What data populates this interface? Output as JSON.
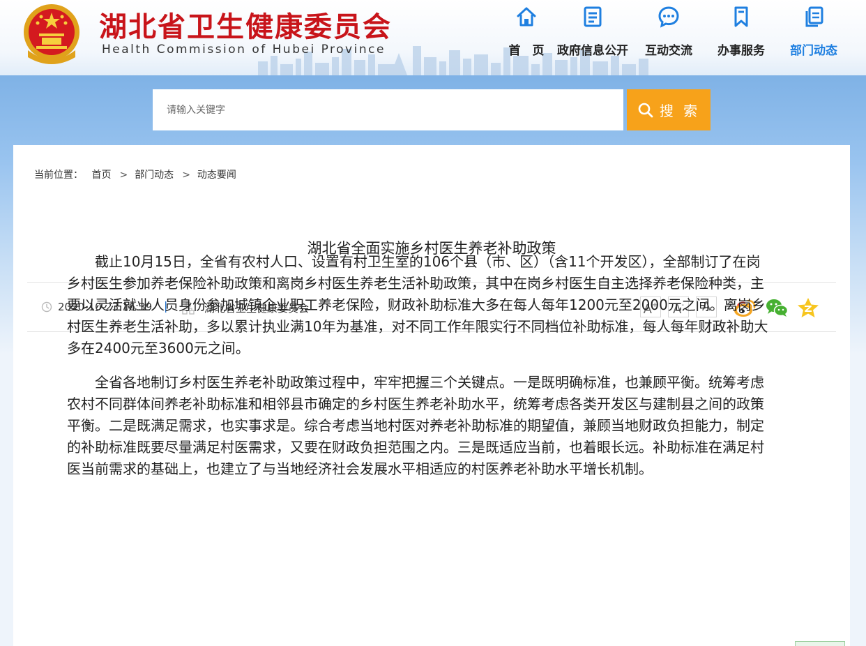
{
  "header": {
    "title": "湖北省卫生健康委员会",
    "subtitle": "Health Commission of Hubei Province",
    "emblem_icon": "national-emblem-icon",
    "title_color": "#c8141a"
  },
  "nav": {
    "accent_color": "#1e7fe0",
    "items": [
      {
        "label": "首　页",
        "icon": "home-icon"
      },
      {
        "label": "政府信息公开",
        "icon": "document-list-icon"
      },
      {
        "label": "互动交流",
        "icon": "chat-bubble-icon"
      },
      {
        "label": "办事服务",
        "icon": "bookmark-icon"
      },
      {
        "label": "部门动态",
        "icon": "copy-pages-icon",
        "active": true
      }
    ]
  },
  "search": {
    "placeholder": "请输入关键字",
    "button_label": "搜 索",
    "button_color": "#f7a21a"
  },
  "breadcrumb": {
    "prefix": "当前位置：",
    "items": [
      "首页",
      "部门动态",
      "动态要闻"
    ],
    "separator": ">"
  },
  "article": {
    "title": "湖北省全面实施乡村医生养老补助政策",
    "date": "2020-10-23 16:39",
    "divider": "|",
    "source": "湖北省卫生健康委员会",
    "font_controls": [
      "A+",
      "A-",
      "A"
    ],
    "share": [
      "weibo-icon",
      "wechat-icon",
      "favorite-star-icon"
    ],
    "paragraphs": [
      "截止10月15日，全省有农村人口、设置有村卫生室的106个县（市、区）（含11个开发区），全部制订了在岗乡村医生参加养老保险补助政策和离岗乡村医生养老生活补助政策，其中在岗乡村医生自主选择养老保险种类，主要以灵活就业人员身份参加城镇企业职工养老保险，财政补助标准大多在每人每年1200元至2000元之间。离岗乡村医生养老生活补助，多以累计执业满10年为基准，对不同工作年限实行不同档位补助标准，每人每年财政补助大多在2400元至3600元之间。",
      "全省各地制订乡村医生养老补助政策过程中，牢牢把握三个关键点。一是既明确标准，也兼顾平衡。统筹考虑农村不同群体间养老补助标准和相邻县市确定的乡村医生养老补助水平，统筹考虑各类开发区与建制县之间的政策平衡。二是既满足需求，也实事求是。综合考虑当地村医对养老补助标准的期望值，兼顾当地财政负担能力，制定的补助标准既要尽量满足村医需求，又要在财政负担范围之内。三是既适应当前，也着眼长远。补助标准在满足村医当前需求的基础上，也建立了与当地经济社会发展水平相适应的村医养老补助水平增长机制。"
    ]
  }
}
